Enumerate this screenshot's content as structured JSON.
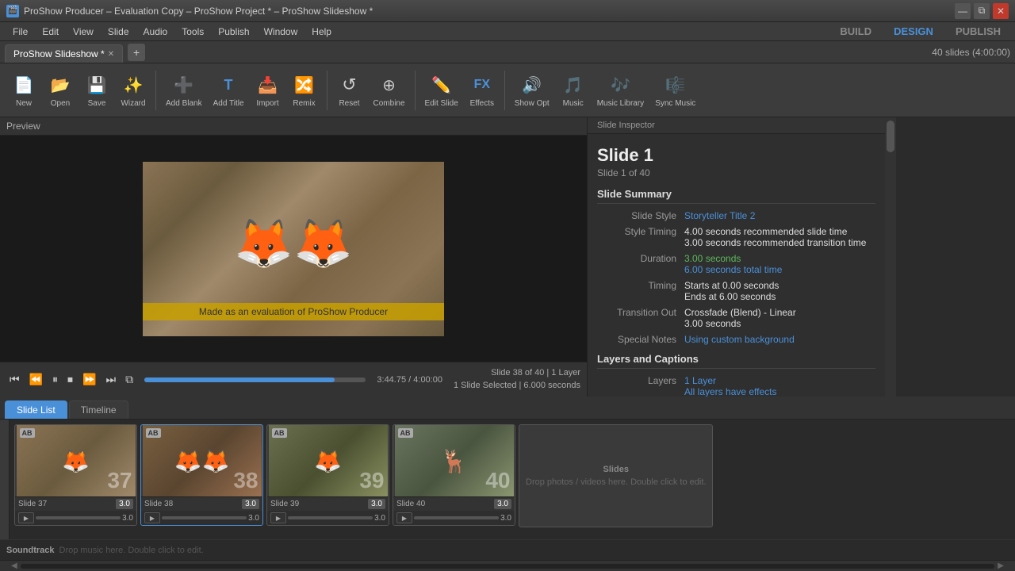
{
  "titlebar": {
    "text": "ProShow Producer – Evaluation Copy – ProShow Project * – ProShow Slideshow *",
    "icon": "🎬"
  },
  "menu": {
    "items": [
      "File",
      "Edit",
      "View",
      "Slide",
      "Audio",
      "Tools",
      "Publish",
      "Window",
      "Help"
    ],
    "mode_buttons": [
      "BUILD",
      "DESIGN",
      "PUBLISH"
    ],
    "active_mode": "DESIGN"
  },
  "tabs": {
    "active_tab": "ProShow Slideshow *",
    "items": [
      "ProShow Slideshow *"
    ]
  },
  "slide_count": "40 slides (4:00:00)",
  "toolbar": {
    "buttons": [
      {
        "id": "new",
        "label": "New",
        "icon": "📄"
      },
      {
        "id": "open",
        "label": "Open",
        "icon": "📂"
      },
      {
        "id": "save",
        "label": "Save",
        "icon": "💾"
      },
      {
        "id": "wizard",
        "label": "Wizard",
        "icon": "✨"
      },
      {
        "id": "add-blank",
        "label": "Add Blank",
        "icon": "➕"
      },
      {
        "id": "add-title",
        "label": "Add Title",
        "icon": "🅣"
      },
      {
        "id": "import",
        "label": "Import",
        "icon": "📥"
      },
      {
        "id": "remix",
        "label": "Remix",
        "icon": "🔀"
      },
      {
        "id": "reset",
        "label": "Reset",
        "icon": "↺"
      },
      {
        "id": "combine",
        "label": "Combine",
        "icon": "⊕"
      },
      {
        "id": "edit-slide",
        "label": "Edit Slide",
        "icon": "✏️"
      },
      {
        "id": "effects",
        "label": "Effects",
        "icon": "FX"
      },
      {
        "id": "show-opt",
        "label": "Show Opt",
        "icon": "🔊"
      },
      {
        "id": "music",
        "label": "Music",
        "icon": "🎵"
      },
      {
        "id": "music-library",
        "label": "Music Library",
        "icon": "🎶"
      },
      {
        "id": "sync-music",
        "label": "Sync Music",
        "icon": "🎼"
      }
    ]
  },
  "preview": {
    "label": "Preview",
    "watermark": "Made as an evaluation of  ProShow Producer",
    "time_current": "3:44.75",
    "time_total": "4:00:00",
    "slide_info_line1": "Slide 38 of 40  |  1 Layer",
    "slide_info_line2": "1 Slide Selected  |  6.000 seconds"
  },
  "controls": {
    "buttons": [
      "⏮",
      "⏪",
      "⏸",
      "⏹",
      "⏩",
      "⏭",
      "⧉"
    ]
  },
  "inspector": {
    "label": "Slide Inspector",
    "slide_title": "Slide 1",
    "slide_subtitle": "Slide 1 of 40",
    "summary_title": "Slide Summary",
    "rows": [
      {
        "label": "Slide Style",
        "value": "Storyteller Title 2",
        "type": "link"
      },
      {
        "label": "Style Timing",
        "value": "4.00 seconds recommended slide time\n3.00 seconds recommended transition time",
        "type": "text"
      },
      {
        "label": "Duration",
        "value": "3.00 seconds",
        "type": "green",
        "value2": "6.00 seconds total time",
        "type2": "link"
      },
      {
        "label": "Timing",
        "value": "Starts at 0.00 seconds\nEnds at 6.00 seconds",
        "type": "text"
      },
      {
        "label": "Transition Out",
        "value": "Crossfade (Blend) - Linear\n3.00 seconds",
        "type": "text"
      },
      {
        "label": "Special Notes",
        "value": "Using custom background",
        "type": "link"
      }
    ],
    "layers_title": "Layers and Captions",
    "layers_label": "Layers",
    "layers_value": "1 Layer",
    "layers_note": "All layers have effects"
  },
  "slide_list": {
    "tabs": [
      "Slide List",
      "Timeline"
    ],
    "active_tab": "Slide List",
    "slides": [
      {
        "id": "37",
        "name": "Slide 37",
        "number": "37",
        "duration": "3.0"
      },
      {
        "id": "38",
        "name": "Slide 38",
        "number": "38",
        "duration": "3.0"
      },
      {
        "id": "39",
        "name": "Slide 39",
        "number": "39",
        "duration": "3.0"
      },
      {
        "id": "40",
        "name": "Slide 40",
        "number": "40",
        "duration": "3.0"
      }
    ],
    "empty_label": "Slides",
    "empty_hint": "Drop photos / videos here. Double click to edit."
  },
  "soundtrack": {
    "label": "Soundtrack",
    "hint": "Drop music here. Double click to edit."
  }
}
